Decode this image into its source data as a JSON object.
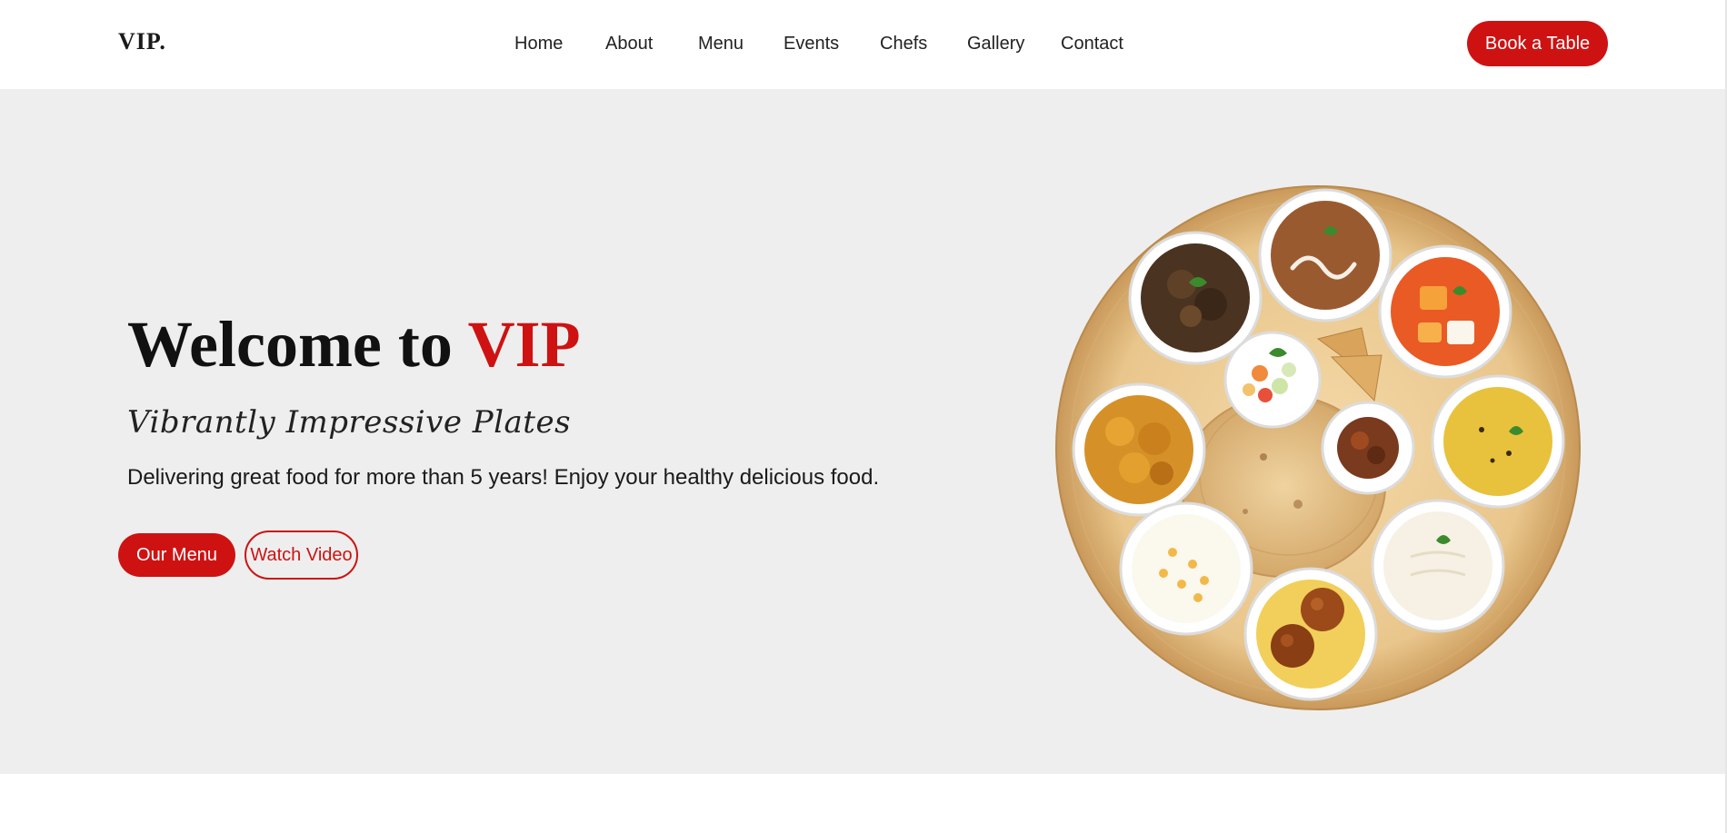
{
  "brand": {
    "logo": "VIP."
  },
  "nav": {
    "items": [
      {
        "label": "Home"
      },
      {
        "label": "About"
      },
      {
        "label": "Menu"
      },
      {
        "label": "Events"
      },
      {
        "label": "Chefs"
      },
      {
        "label": "Gallery"
      },
      {
        "label": "Contact"
      }
    ],
    "cta": "Book a Table"
  },
  "hero": {
    "title_prefix": "Welcome to ",
    "title_accent": "VIP",
    "subtitle": "Vibrantly Impressive Plates",
    "description": "Delivering great food for more than 5 years! Enjoy your healthy delicious food.",
    "primary_button": "Our Menu",
    "secondary_button": "Watch Video"
  },
  "colors": {
    "accent": "#ce1212",
    "hero_background": "#eeeeee",
    "header_background": "#ffffff"
  }
}
